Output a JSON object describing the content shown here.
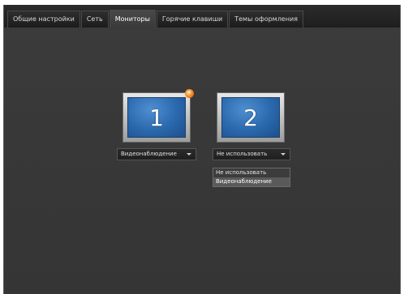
{
  "tabs": [
    {
      "label": "Общие настройки"
    },
    {
      "label": "Сеть"
    },
    {
      "label": "Мониторы"
    },
    {
      "label": "Горячие клавиши"
    },
    {
      "label": "Темы оформления"
    }
  ],
  "active_tab": "Мониторы",
  "monitors": [
    {
      "number": "1",
      "mode": "Видеонаблюдение",
      "badge": "*"
    },
    {
      "number": "2",
      "mode": "Не использовать"
    }
  ],
  "dropdown_options": [
    "Не использовать",
    "Видеонаблюдение"
  ],
  "colors": {
    "accent_screen": "#2a68ad",
    "badge": "#f07a1a",
    "background": "#3a3a3a"
  }
}
